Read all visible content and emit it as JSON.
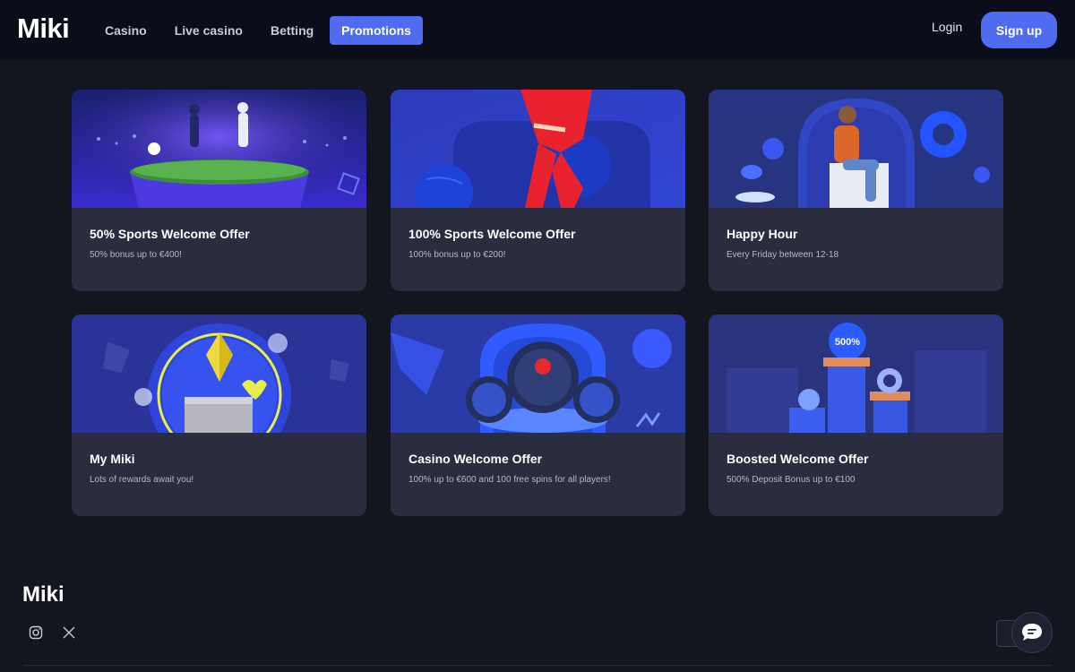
{
  "header": {
    "logo": "Miki",
    "nav": [
      {
        "label": "Casino"
      },
      {
        "label": "Live casino"
      },
      {
        "label": "Betting"
      },
      {
        "label": "Promotions"
      }
    ],
    "login": "Login",
    "signup": "Sign up"
  },
  "promotions": [
    {
      "title": "50% Sports Welcome Offer",
      "subtitle": "50% bonus up to €400!"
    },
    {
      "title": "100% Sports Welcome Offer",
      "subtitle": "100% bonus up to €200!"
    },
    {
      "title": "Happy Hour",
      "subtitle": "Every Friday between 12-18"
    },
    {
      "title": "My Miki",
      "subtitle": "Lots of rewards await you!"
    },
    {
      "title": "Casino Welcome Offer",
      "subtitle": "100% up to €600 and 100 free spins for all players!"
    },
    {
      "title": "Boosted Welcome Offer",
      "subtitle": "500% Deposit Bonus up to €100"
    }
  ],
  "badges": {
    "boost": "500%"
  },
  "footer": {
    "logo": "Miki"
  },
  "colors": {
    "accent": "#4f6bef",
    "card": "#2a2d3d",
    "background": "#14161f",
    "header": "#0b0e1a"
  },
  "icons": [
    "instagram-icon",
    "x-twitter-icon",
    "chat-icon"
  ]
}
